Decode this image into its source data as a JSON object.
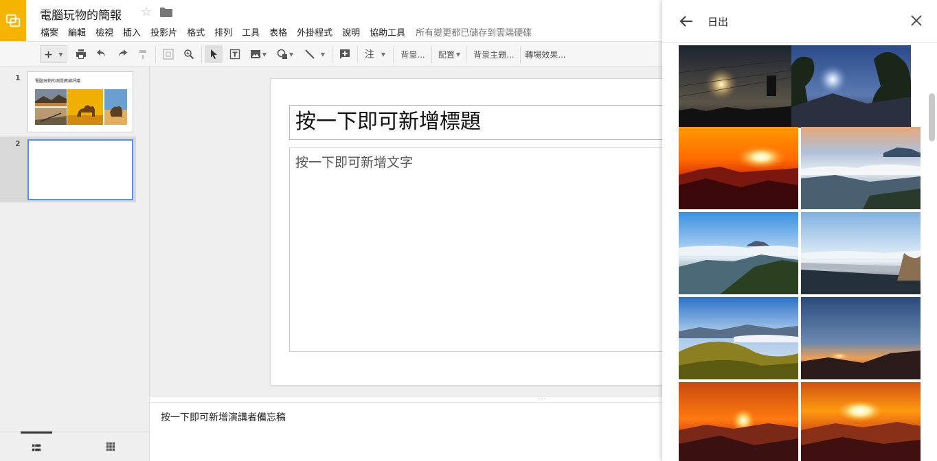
{
  "header": {
    "doc_title": "電腦玩物的簡報",
    "menu": [
      "檔案",
      "編輯",
      "檢視",
      "插入",
      "投影片",
      "格式",
      "排列",
      "工具",
      "表格",
      "外掛程式",
      "說明",
      "協助工具"
    ],
    "save_status": "所有變更都已儲存到雲端硬碟"
  },
  "toolbar": {
    "comment_label": "注",
    "background_label": "背景...",
    "layout_label": "配置",
    "theme_label": "背景主題...",
    "transition_label": "轉場效果..."
  },
  "filmstrip": {
    "slides": [
      {
        "number": "1",
        "thumb_title": "電腦玩物的測覺教練評議"
      },
      {
        "number": "2"
      }
    ]
  },
  "slide": {
    "title_placeholder": "按一下即可新增標題",
    "body_placeholder": "按一下即可新增文字"
  },
  "notes": {
    "placeholder": "按一下即可新增演講者備忘稿"
  },
  "panel": {
    "title": "日出"
  },
  "colors": {
    "logo_accent": "#f4b400",
    "selection_blue": "#4d90fe"
  }
}
